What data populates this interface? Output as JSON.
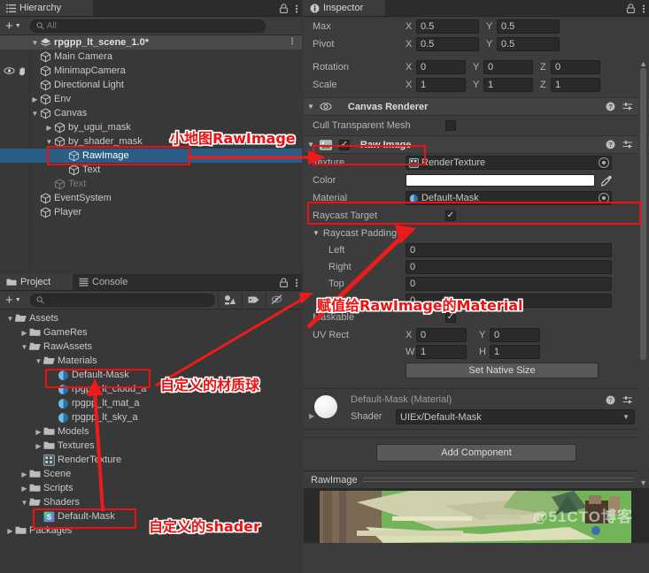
{
  "hierarchy": {
    "tab_label": "Hierarchy",
    "icon": "hierarchy-icon",
    "lock_icon": "lock-icon",
    "menu_icon": "kebab-menu-icon",
    "add_label": "+",
    "search_placeholder": "All",
    "scene_name": "rpgpp_lt_scene_1.0*",
    "items": [
      {
        "label": "Main Camera",
        "depth": 1,
        "twisty": "",
        "dim": false,
        "selected": false
      },
      {
        "label": "MinimapCamera",
        "depth": 1,
        "twisty": "",
        "dim": false,
        "selected": false,
        "vis": true
      },
      {
        "label": "Directional Light",
        "depth": 1,
        "twisty": "",
        "dim": false,
        "selected": false
      },
      {
        "label": "Env",
        "depth": 1,
        "twisty": "collapsed",
        "dim": false,
        "selected": false
      },
      {
        "label": "Canvas",
        "depth": 1,
        "twisty": "expanded",
        "dim": false,
        "selected": false
      },
      {
        "label": "by_ugui_mask",
        "depth": 2,
        "twisty": "collapsed",
        "dim": false,
        "selected": false
      },
      {
        "label": "by_shader_mask",
        "depth": 2,
        "twisty": "expanded",
        "dim": false,
        "selected": false
      },
      {
        "label": "RawImage",
        "depth": 3,
        "twisty": "",
        "dim": false,
        "selected": true
      },
      {
        "label": "Text",
        "depth": 3,
        "twisty": "",
        "dim": false,
        "selected": false
      },
      {
        "label": "Text",
        "depth": 2,
        "twisty": "",
        "dim": true,
        "selected": false
      },
      {
        "label": "EventSystem",
        "depth": 1,
        "twisty": "",
        "dim": false,
        "selected": false
      },
      {
        "label": "Player",
        "depth": 1,
        "twisty": "",
        "dim": false,
        "selected": false
      }
    ]
  },
  "project": {
    "tab_label": "Project",
    "console_tab_label": "Console",
    "project_icon": "folder-icon",
    "console_icon": "console-icon",
    "lock_icon": "lock-icon",
    "menu_icon": "kebab-menu-icon",
    "add_label": "+",
    "search_placeholder": "",
    "toolbar_icons": [
      "asset-filter-icon",
      "label-filter-icon",
      "scene-vis-off-icon"
    ],
    "items": [
      {
        "label": "Assets",
        "depth": 0,
        "twisty": "expanded",
        "icon": "folder-open-icon"
      },
      {
        "label": "GameRes",
        "depth": 1,
        "twisty": "collapsed",
        "icon": "folder-icon"
      },
      {
        "label": "RawAssets",
        "depth": 1,
        "twisty": "expanded",
        "icon": "folder-open-icon"
      },
      {
        "label": "Materials",
        "depth": 2,
        "twisty": "expanded",
        "icon": "folder-open-icon"
      },
      {
        "label": "Default-Mask",
        "depth": 3,
        "twisty": "",
        "icon": "material-icon"
      },
      {
        "label": "rpgpp_lt_cloud_a",
        "depth": 3,
        "twisty": "",
        "icon": "material-icon"
      },
      {
        "label": "rpgpp_lt_mat_a",
        "depth": 3,
        "twisty": "",
        "icon": "material-icon"
      },
      {
        "label": "rpgpp_lt_sky_a",
        "depth": 3,
        "twisty": "",
        "icon": "material-icon"
      },
      {
        "label": "Models",
        "depth": 2,
        "twisty": "collapsed",
        "icon": "folder-icon"
      },
      {
        "label": "Textures",
        "depth": 2,
        "twisty": "collapsed",
        "icon": "folder-icon"
      },
      {
        "label": "RenderTexture",
        "depth": 2,
        "twisty": "",
        "icon": "render-texture-icon"
      },
      {
        "label": "Scene",
        "depth": 1,
        "twisty": "collapsed",
        "icon": "folder-icon"
      },
      {
        "label": "Scripts",
        "depth": 1,
        "twisty": "collapsed",
        "icon": "folder-icon"
      },
      {
        "label": "Shaders",
        "depth": 1,
        "twisty": "expanded",
        "icon": "folder-open-icon"
      },
      {
        "label": "Default-Mask",
        "depth": 2,
        "twisty": "",
        "icon": "shader-icon"
      },
      {
        "label": "Packages",
        "depth": 0,
        "twisty": "collapsed",
        "icon": "folder-icon"
      }
    ]
  },
  "inspector": {
    "tab_label": "Inspector",
    "tab_icon": "info-icon",
    "lock_icon": "lock-icon",
    "menu_icon": "kebab-menu-icon",
    "rect_transform": {
      "rows": [
        {
          "label": "Max",
          "fields": [
            {
              "axis": "X",
              "value": "0.5"
            },
            {
              "axis": "Y",
              "value": "0.5"
            }
          ]
        },
        {
          "label": "Pivot",
          "fields": [
            {
              "axis": "X",
              "value": "0.5"
            },
            {
              "axis": "Y",
              "value": "0.5"
            }
          ]
        },
        {
          "label": "Rotation",
          "fields": [
            {
              "axis": "X",
              "value": "0"
            },
            {
              "axis": "Y",
              "value": "0"
            },
            {
              "axis": "Z",
              "value": "0"
            }
          ]
        },
        {
          "label": "Scale",
          "fields": [
            {
              "axis": "X",
              "value": "1"
            },
            {
              "axis": "Y",
              "value": "1"
            },
            {
              "axis": "Z",
              "value": "1"
            }
          ]
        }
      ]
    },
    "canvas_renderer": {
      "title": "Canvas Renderer",
      "visibility_icon": "eye-icon",
      "help_icon": "help-icon",
      "preset_icon": "preset-icon",
      "menu_icon": "kebab-menu-icon",
      "cull_label": "Cull Transparent Mesh",
      "cull_checked": false
    },
    "raw_image": {
      "title": "Raw Image",
      "component_icon": "raw-image-icon",
      "enabled": true,
      "help_icon": "help-icon",
      "preset_icon": "preset-icon",
      "menu_icon": "kebab-menu-icon",
      "texture_label": "Texture",
      "texture_value": "RenderTexture",
      "texture_icon": "render-texture-icon",
      "color_label": "Color",
      "color_value": "#FFFFFF",
      "eyedropper_icon": "eyedropper-icon",
      "material_label": "Material",
      "material_value": "Default-Mask",
      "material_icon": "material-icon",
      "raycast_target_label": "Raycast Target",
      "raycast_target_checked": true,
      "raycast_padding_label": "Raycast Padding",
      "padding": [
        {
          "label": "Left",
          "value": "0"
        },
        {
          "label": "Right",
          "value": "0"
        },
        {
          "label": "Top",
          "value": "0"
        },
        {
          "label": "Bottom",
          "value": "0"
        }
      ],
      "maskable_label": "Maskable",
      "maskable_checked": true,
      "uv_rect_label": "UV Rect",
      "uv_rect": [
        {
          "axis": "X",
          "value": "0"
        },
        {
          "axis": "Y",
          "value": "0"
        },
        {
          "axis": "W",
          "value": "1"
        },
        {
          "axis": "H",
          "value": "1"
        }
      ],
      "set_native_size_label": "Set Native Size"
    },
    "material_inspector": {
      "title": "Default-Mask (Material)",
      "shader_label": "Shader",
      "shader_value": "UIEx/Default-Mask",
      "help_icon": "help-icon",
      "preset_icon": "preset-icon",
      "menu_icon": "kebab-menu-icon"
    },
    "add_component_label": "Add Component",
    "preview": {
      "title": "RawImage",
      "menu_icon": "kebab-menu-icon",
      "watermark": "@51CTO博客"
    }
  },
  "annotations": [
    {
      "id": "anno-minimap-rawimage",
      "text": "小地图RawImage"
    },
    {
      "id": "anno-assign-material",
      "text": "赋值给RawImage的Material"
    },
    {
      "id": "anno-custom-material",
      "text": "自定义的材质球"
    },
    {
      "id": "anno-custom-shader",
      "text": "自定义的shader"
    }
  ],
  "colors": {
    "accent_red": "#ee1111",
    "selection_blue": "#2c5d87",
    "panel_bg": "#383838",
    "inspector_bg": "#3c3c3c"
  }
}
